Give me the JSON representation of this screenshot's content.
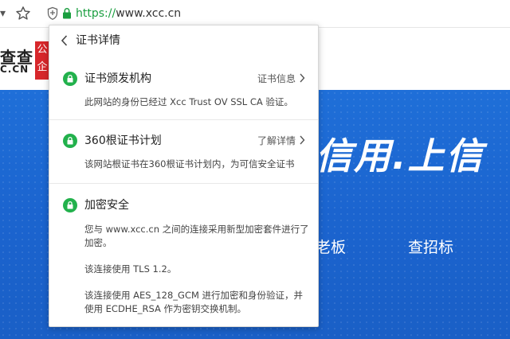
{
  "browser": {
    "url_scheme": "https://",
    "url_host": "www.xcc.cn"
  },
  "page": {
    "logo_text": "查查",
    "logo_domain": "C.CN",
    "logo_badge_1": "公",
    "logo_badge_2": "企",
    "banner_slogan": "信用.上信",
    "nav_items": [
      "老板",
      "查招标"
    ]
  },
  "popup": {
    "title": "证书详情",
    "sections": [
      {
        "title": "证书颁发机构",
        "link": "证书信息",
        "desc": "此网站的身份已经过 Xcc Trust OV SSL CA 验证。"
      },
      {
        "title": "360根证书计划",
        "link": "了解详情",
        "desc": "该网站根证书在360根证书计划内，为可信安全证书"
      },
      {
        "title": "加密安全",
        "desc1": "您与 www.xcc.cn 之间的连接采用新型加密套件进行了加密。",
        "desc2": "该连接使用 TLS 1.2。",
        "desc3": "该连接使用 AES_128_GCM 进行加密和身份验证，并使用 ECDHE_RSA 作为密钥交换机制。"
      }
    ]
  },
  "colors": {
    "secure_green": "#22b14c",
    "url_green": "#1a9e3f",
    "banner_blue": "#1f6fd8",
    "logo_red": "#d7272b"
  },
  "icons": {
    "star": "star-icon",
    "shield": "shield-icon",
    "lock": "lock-icon",
    "back": "chevron-left-icon",
    "forward": "chevron-right-icon"
  }
}
